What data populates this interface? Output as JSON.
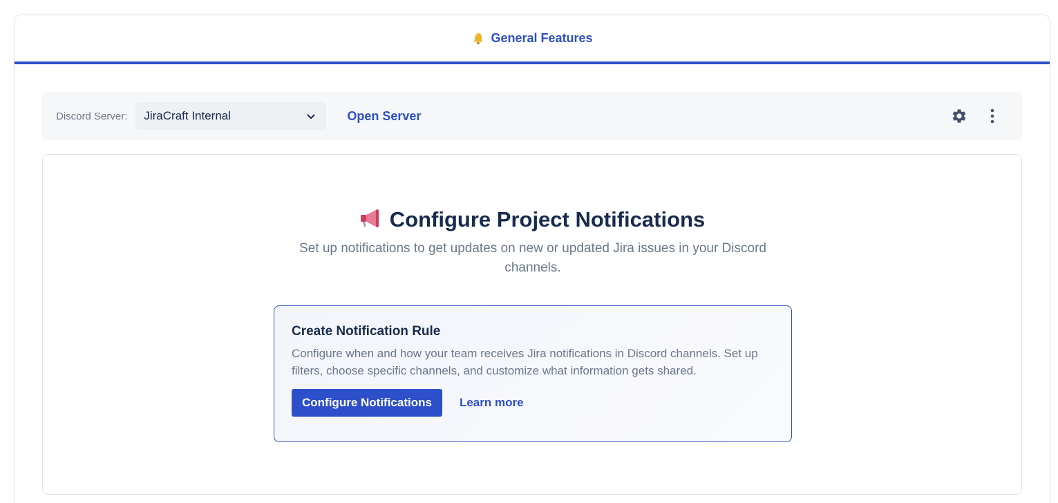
{
  "tabs": [
    {
      "label": "General Features",
      "icon": "bell-icon",
      "active": true
    }
  ],
  "toolbar": {
    "server_label": "Discord Server:",
    "server_selected": "JiraCraft Internal",
    "open_server_label": "Open Server",
    "icons": [
      "gear-icon",
      "more-vertical-icon"
    ]
  },
  "main": {
    "heading": "Configure Project Notifications",
    "heading_icon": "megaphone-icon",
    "subtitle": "Set up notifications to get updates on new or updated Jira issues in your Discord channels.",
    "rule_card": {
      "title": "Create Notification Rule",
      "description": "Configure when and how your team receives Jira notifications in Discord channels. Set up filters, choose specific channels, and customize what information gets shared.",
      "primary_button": "Configure Notifications",
      "link": "Learn more"
    }
  },
  "colors": {
    "accent": "#2d4fc9",
    "text_primary": "#172b4d",
    "text_secondary": "#6b778c",
    "toolbar_bg": "#f6f7f9"
  }
}
